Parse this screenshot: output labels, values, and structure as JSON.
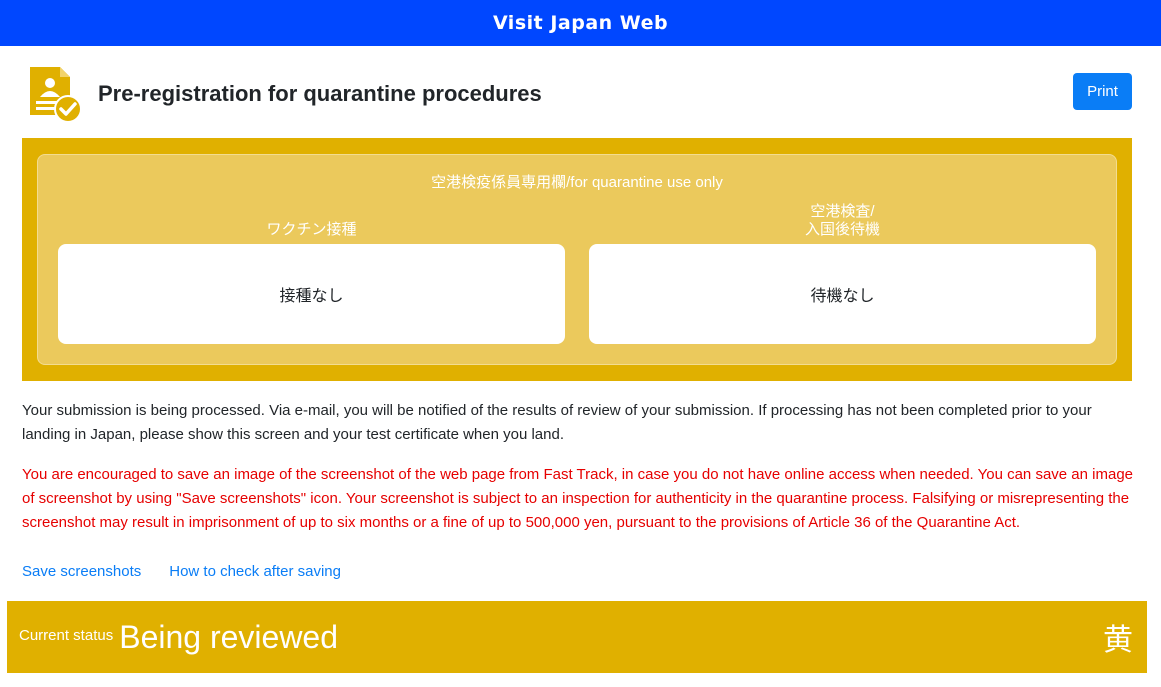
{
  "app": {
    "title": "Visit Japan Web"
  },
  "header": {
    "title": "Pre-registration for quarantine procedures",
    "print_label": "Print",
    "icon": "certificate-check-icon"
  },
  "quarantine": {
    "heading": "空港検疫係員専用欄/for quarantine use only",
    "vaccination": {
      "label": "ワクチン接種",
      "value": "接種なし"
    },
    "airport_test": {
      "label_line1": "空港検査/",
      "label_line2": "入国後待機",
      "value": "待機なし"
    }
  },
  "messages": {
    "info": "Your submission is being processed. Via e-mail, you will be notified of the results of review of your submission. If processing has not been completed prior to your landing in Japan, please show this screen and your test certificate when you land.",
    "warning": "You are encouraged to save an image of the screenshot of the web page from Fast Track, in case you do not have online access when needed. You can save an image of screenshot by using \"Save screenshots\" icon. Your screenshot is subject to an inspection for authenticity in the quarantine process. Falsifying or misrepresenting the screenshot may result in imprisonment of up to six months or a fine of up to 500,000 yen, pursuant to the provisions of Article 36 of the Quarantine Act."
  },
  "links": {
    "save_screenshots": "Save screenshots",
    "how_to_check": "How to check after saving"
  },
  "status": {
    "label": "Current status",
    "value": "Being reviewed",
    "color_label": "黄"
  },
  "colors": {
    "brand_blue": "#0047ff",
    "status_yellow": "#e0b000",
    "link_blue": "#0a7df6",
    "warning_red": "#e60000"
  }
}
